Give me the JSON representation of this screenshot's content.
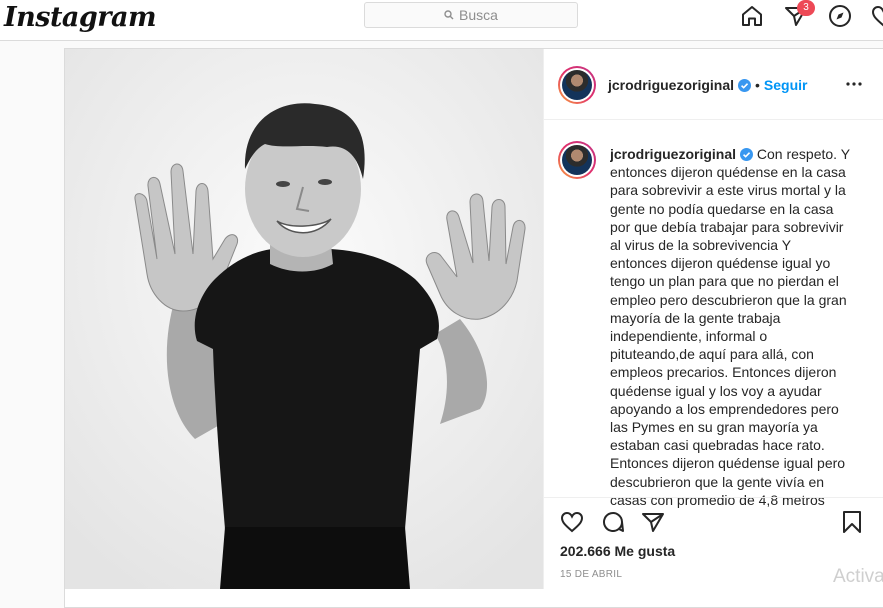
{
  "topbar": {
    "logo": "Instagram",
    "search_placeholder": "Busca",
    "notification_count": "3"
  },
  "post": {
    "username": "jcrodriguezoriginal",
    "follow_label": "Seguir",
    "separator": "•",
    "caption_username": "jcrodriguezoriginal",
    "caption_text": "Con respeto. Y entonces dijeron quédense en la casa para sobrevivir a este virus mortal y la gente no podía quedarse en la casa por que debía trabajar para sobrevivir al virus de la sobrevivencia Y entonces dijeron quédense igual yo tengo un plan para que no pierdan el empleo pero descubrieron que la gran mayoría de la gente trabaja independiente, informal o pituteando,de aquí para allá, con empleos precarios. Entonces dijeron quédense igual y los voy a ayudar apoyando a los emprendedores pero las Pymes en su gran mayoría ya estaban casi quebradas hace rato. Entonces dijeron quédense igual pero descubrieron que la gente vivía en casas con promedio de 4,8 metros",
    "likes": "202.666 Me gusta",
    "date": "15 DE ABRIL"
  },
  "overlay": {
    "activate_text": "Activa"
  },
  "icons": {
    "home": "home-icon",
    "direct": "direct-icon",
    "explore": "compass-icon",
    "activity": "heart-icon",
    "like": "heart-icon",
    "comment": "comment-icon",
    "share": "share-icon",
    "save": "bookmark-icon",
    "verified": "verified-badge-icon",
    "more": "more-options-icon"
  },
  "colors": {
    "accent": "#0095f6",
    "verified": "#3897f0",
    "badge": "#ed4956"
  }
}
